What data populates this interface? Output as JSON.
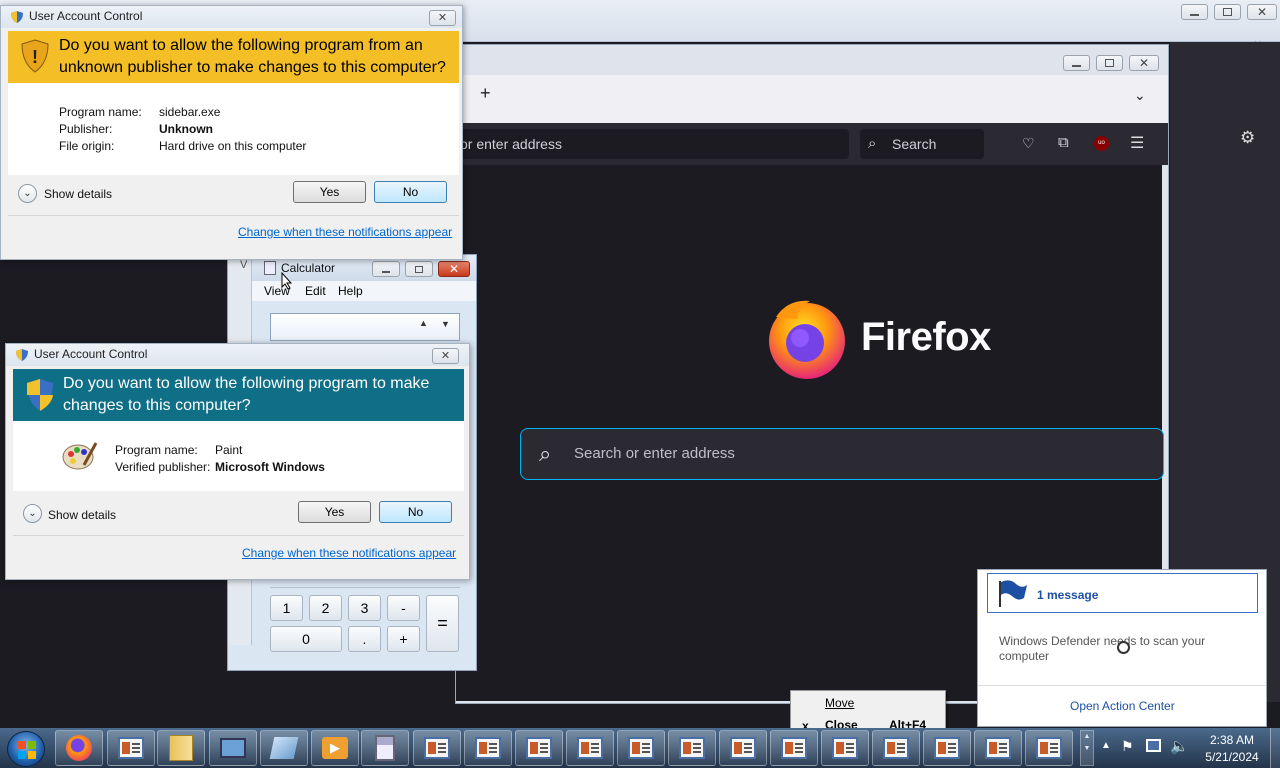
{
  "uac1": {
    "title": "User Account Control",
    "heading": "Do you want to allow the following program from an unknown publisher to make changes to this computer?",
    "program_label": "Program name:",
    "program_value": "sidebar.exe",
    "publisher_label": "Publisher:",
    "publisher_value": "Unknown",
    "origin_label": "File origin:",
    "origin_value": "Hard drive on this computer",
    "show_details": "Show details",
    "yes": "Yes",
    "no": "No",
    "change_link": "Change when these notifications appear",
    "banner_color": "#f4be27"
  },
  "uac2": {
    "title": "User Account Control",
    "heading": "Do you want to allow the following program to make changes to this computer?",
    "program_label": "Program name:",
    "program_value": "Paint",
    "publisher_label": "Verified publisher:",
    "publisher_value": "Microsoft Windows",
    "show_details": "Show details",
    "yes": "Yes",
    "no": "No",
    "change_link": "Change when these notifications appear",
    "banner_color": "#0f6f86"
  },
  "firefox": {
    "url_placeholder": "or enter address",
    "search_label": "Search",
    "brand": "Firefox",
    "big_search_placeholder": "Search or enter address",
    "new_tab": "+",
    "accent": "#00b3f4"
  },
  "calculator": {
    "title": "Calculator",
    "menu": [
      "View",
      "Edit",
      "Help"
    ],
    "keys": [
      "1",
      "2",
      "3",
      "-",
      "0",
      ".",
      "+",
      "="
    ]
  },
  "notification": {
    "header": "1 message",
    "body": "Windows Defender needs to scan your computer",
    "action": "Open Action Center"
  },
  "context_menu": {
    "move": "Move",
    "close_mark": "x",
    "close": "Close",
    "close_shortcut": "Alt+F4"
  },
  "clock": {
    "time": "2:38 AM",
    "date": "5/21/2024"
  }
}
